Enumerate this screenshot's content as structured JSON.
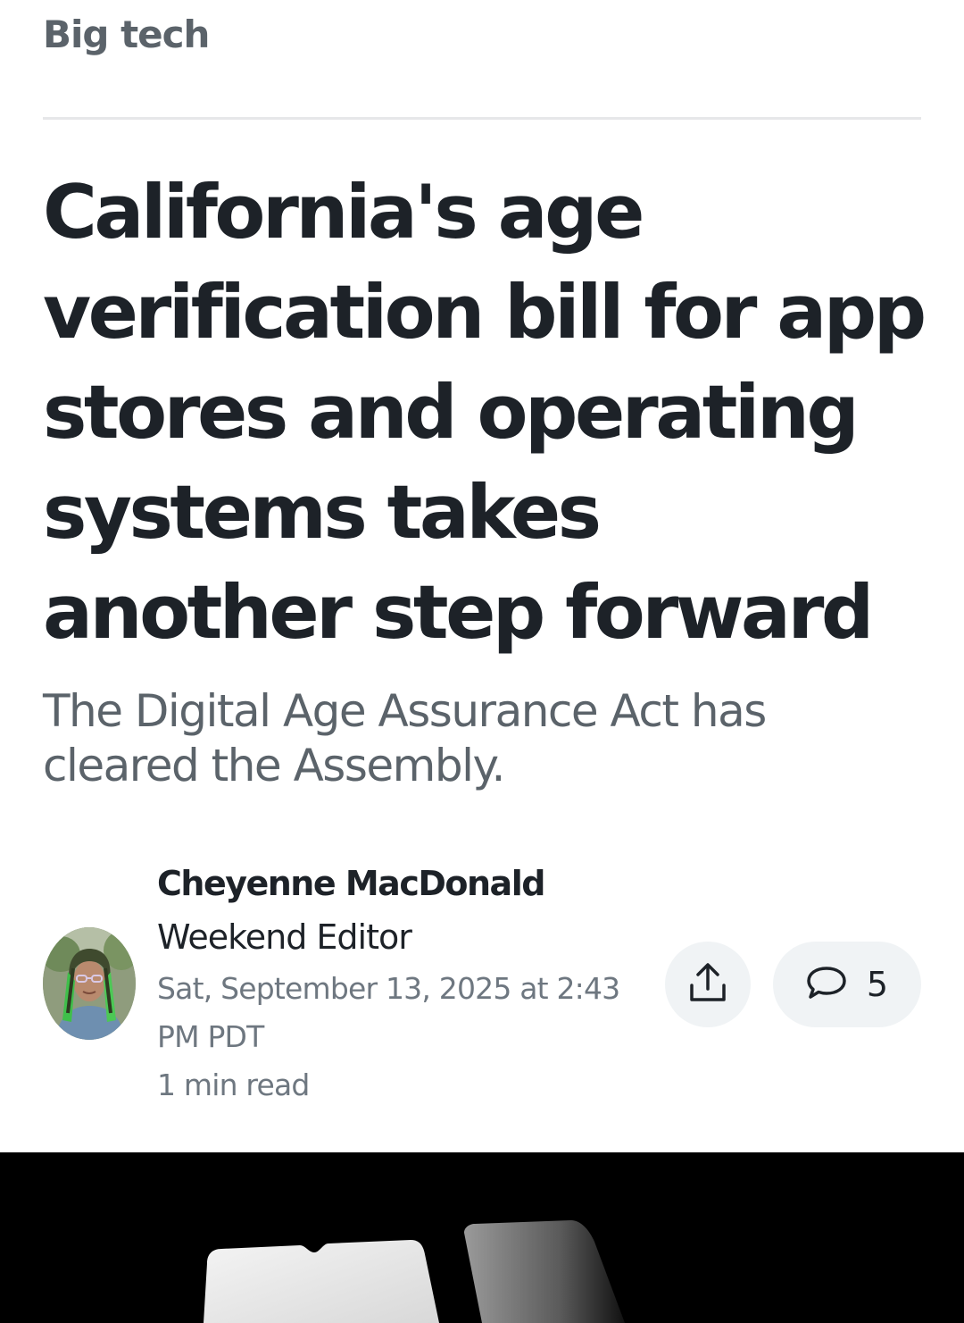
{
  "section": {
    "label": "Big tech"
  },
  "article": {
    "headline": "California's age verification bill for app stores and operating systems takes another step forward",
    "dek": "The Digital Age Assurance Act has cleared the Assembly."
  },
  "byline": {
    "author_name": "Cheyenne MacDonald",
    "author_title": "Weekend Editor",
    "timestamp": "Sat, September 13, 2025 at 2:43 PM PDT",
    "read_time": "1 min read"
  },
  "actions": {
    "share_icon": "share-upload-icon",
    "comment_icon": "comment-bubble-icon",
    "comment_count": "5"
  },
  "colors": {
    "headline": "#1d2228",
    "secondary_text": "#5b636a",
    "meta_text": "#6e7780",
    "button_bg": "#f0f3f5",
    "hero_bg": "#000000"
  }
}
